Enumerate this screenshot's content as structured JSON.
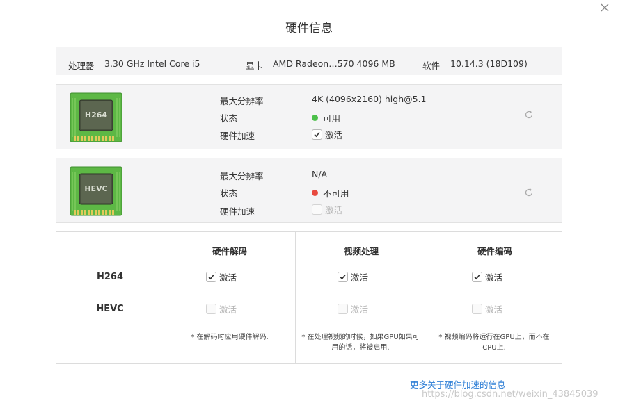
{
  "window": {
    "title": "硬件信息",
    "close_icon": "close-icon"
  },
  "system": {
    "processor_label": "处理器",
    "processor_value": "3.30 GHz Intel Core i5",
    "gpu_label": "显卡",
    "gpu_value": "AMD Radeon…570 4096 MB",
    "software_label": "软件",
    "software_value": "10.14.3 (18D109)"
  },
  "codecs": [
    {
      "chip_label": "H264",
      "max_res_label": "最大分辨率",
      "max_res_value": "4K (4096x2160) high@5.1",
      "status_label": "状态",
      "status_value": "可用",
      "status_color": "#4cc04a",
      "accel_label": "硬件加速",
      "accel_text": "激活",
      "accel_checked": true,
      "accel_enabled": true
    },
    {
      "chip_label": "HEVC",
      "max_res_label": "最大分辨率",
      "max_res_value": "N/A",
      "status_label": "状态",
      "status_value": "不可用",
      "status_color": "#e8493f",
      "accel_label": "硬件加速",
      "accel_text": "激活",
      "accel_checked": false,
      "accel_enabled": false
    }
  ],
  "table": {
    "columns": [
      "硬件解码",
      "视频处理",
      "硬件编码"
    ],
    "rows": [
      {
        "name": "H264",
        "cells": [
          {
            "text": "激活",
            "checked": true,
            "enabled": true
          },
          {
            "text": "激活",
            "checked": true,
            "enabled": true
          },
          {
            "text": "激活",
            "checked": true,
            "enabled": true
          }
        ]
      },
      {
        "name": "HEVC",
        "cells": [
          {
            "text": "激活",
            "checked": false,
            "enabled": false
          },
          {
            "text": "激活",
            "checked": false,
            "enabled": false
          },
          {
            "text": "激活",
            "checked": false,
            "enabled": false
          }
        ]
      }
    ],
    "notes": [
      "* 在解码时应用硬件解码.",
      "* 在处理视频的时候，如果GPU如果可用的话，将被启用.",
      "* 视频编码将运行在GPU上，而不在CPU上."
    ]
  },
  "more_link": "更多关于硬件加速的信息",
  "watermark": "https://blog.csdn.net/weixin_43845039",
  "colors": {
    "link": "#2f7fd6",
    "panel_bg": "#f4f4f5",
    "chip_green": "#5db845"
  }
}
